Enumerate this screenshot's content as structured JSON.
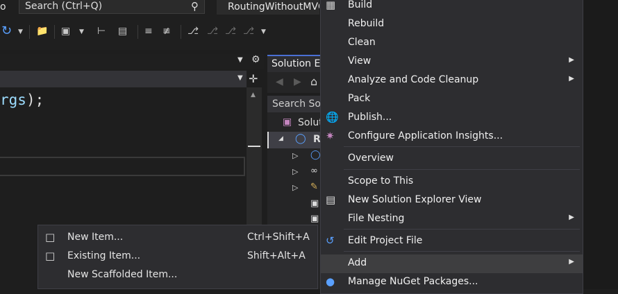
{
  "titlebar": {
    "left_fragment": "o",
    "search_placeholder": "Search (Ctrl+Q)",
    "search_icon": "search-icon",
    "project_title": "RoutingWithoutMVC"
  },
  "editor": {
    "code_param": "rgs",
    "code_punct": ");"
  },
  "solution_explorer": {
    "tab_title": "Solution Explorer",
    "search_placeholder": "Search Solution Explorer",
    "tree": [
      {
        "label": "Solution"
      },
      {
        "label": "R"
      }
    ]
  },
  "add_submenu": {
    "items": [
      {
        "label": "New Item...",
        "shortcut": "Ctrl+Shift+A",
        "icon": "new-item-icon"
      },
      {
        "label": "Existing Item...",
        "shortcut": "Shift+Alt+A",
        "icon": "existing-item-icon"
      },
      {
        "label": "New Scaffolded Item...",
        "shortcut": "",
        "icon": ""
      }
    ]
  },
  "context_menu": {
    "items": [
      {
        "label": "Build"
      },
      {
        "label": "Rebuild"
      },
      {
        "label": "Clean"
      },
      {
        "label": "View"
      },
      {
        "label": "Analyze and Code Cleanup"
      },
      {
        "label": "Pack"
      },
      {
        "label": "Publish..."
      },
      {
        "label": "Configure Application Insights..."
      },
      {
        "label": "Overview"
      },
      {
        "label": "Scope to This"
      },
      {
        "label": "New Solution Explorer View"
      },
      {
        "label": "File Nesting"
      },
      {
        "label": "Edit Project File"
      },
      {
        "label": "Add"
      },
      {
        "label": "Manage NuGet Packages..."
      }
    ]
  },
  "colors": {
    "accent": "#4a6fd4",
    "menu_bg": "#2d2d30",
    "selected_bg": "#3e3e40"
  }
}
